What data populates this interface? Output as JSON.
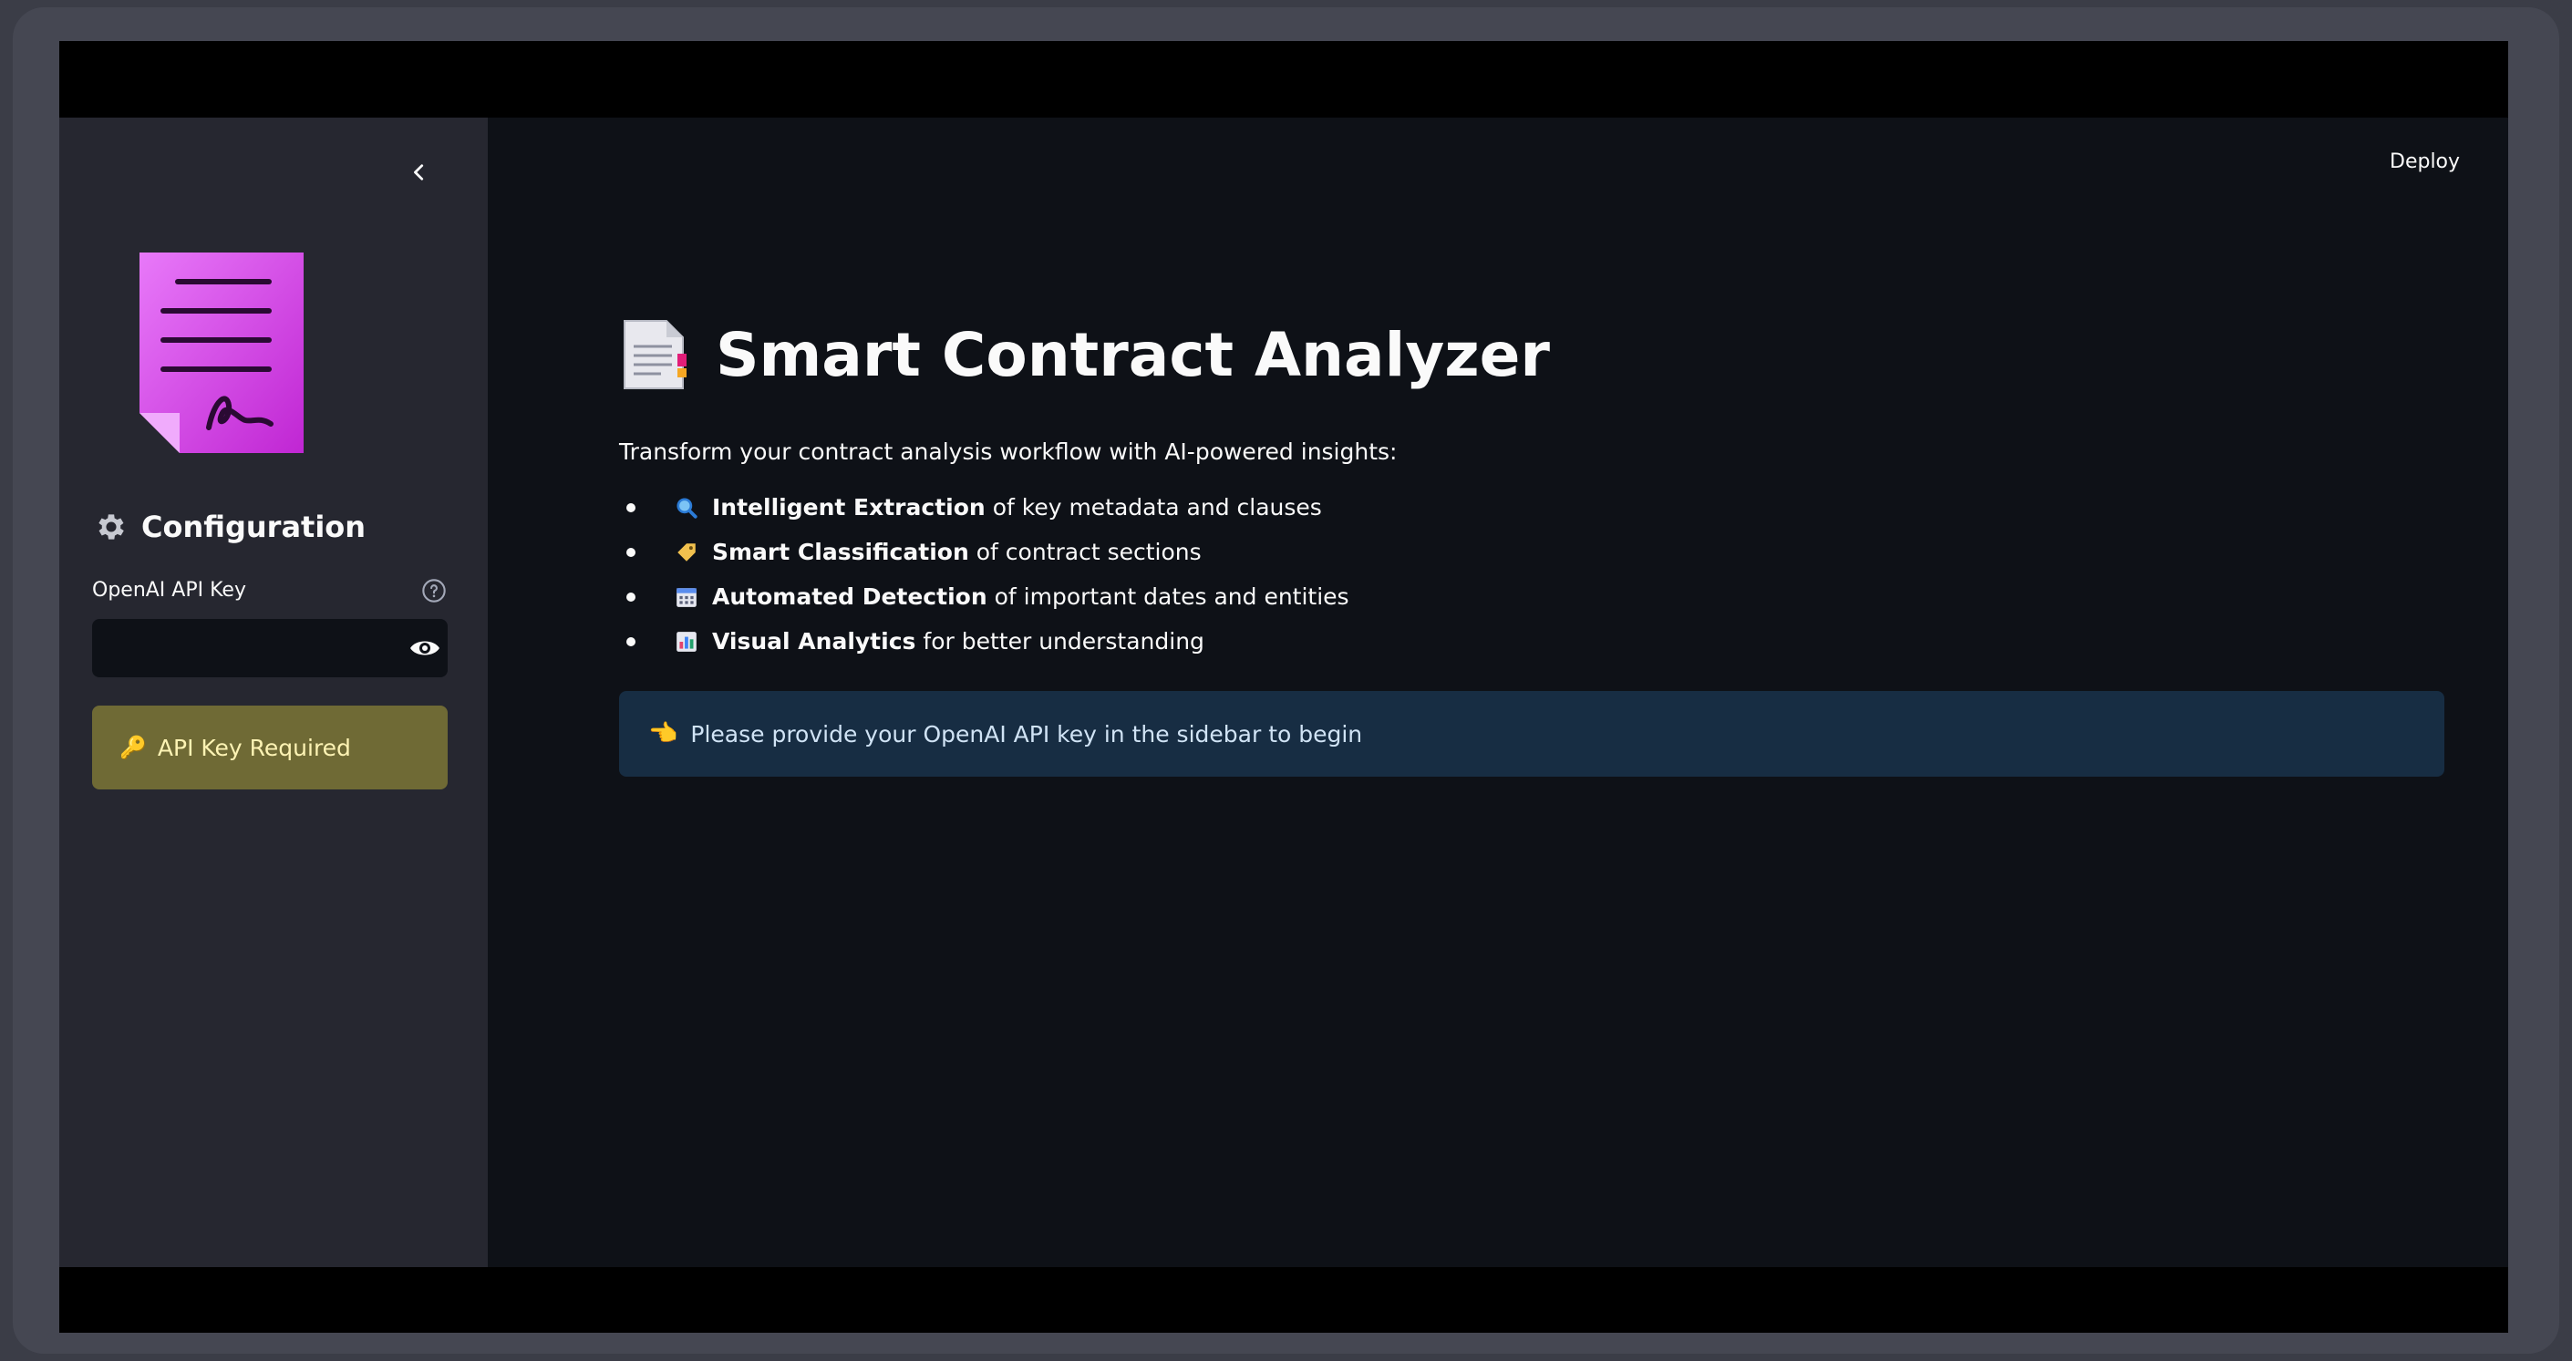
{
  "header": {
    "deploy_label": "Deploy"
  },
  "sidebar": {
    "config_title": "Configuration",
    "api_key_label": "OpenAI API Key",
    "api_key_value": "",
    "api_key_placeholder": "",
    "warning_text": "API Key Required"
  },
  "main": {
    "title": "Smart Contract Analyzer",
    "intro": "Transform your contract analysis workflow with AI-powered insights:",
    "features": [
      {
        "icon": "magnifier-icon",
        "bold": "Intelligent Extraction",
        "rest": "of key metadata and clauses"
      },
      {
        "icon": "tag-icon",
        "bold": "Smart Classification",
        "rest": "of contract sections"
      },
      {
        "icon": "calendar-icon",
        "bold": "Automated Detection",
        "rest": "of important dates and entities"
      },
      {
        "icon": "chart-icon",
        "bold": "Visual Analytics",
        "rest": "for better understanding"
      }
    ],
    "info_text": "Please provide your OpenAI API key in the sidebar to begin"
  },
  "colors": {
    "app_bg": "#0e1117",
    "sidebar_bg": "#262730",
    "warning_bg": "#6f6a35",
    "info_bg": "#172d43",
    "logo_accent": "#d946ef"
  }
}
